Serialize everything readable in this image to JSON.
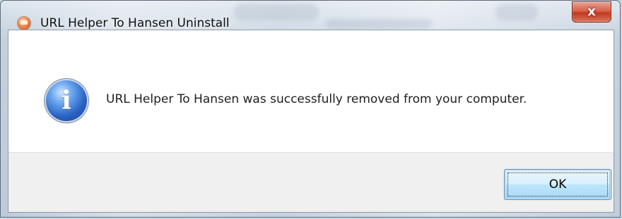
{
  "window": {
    "title": "URL Helper To Hansen Uninstall",
    "app_icon": "installer-app-icon",
    "close_symbol": "x"
  },
  "message": {
    "icon": "info-icon",
    "icon_glyph": "i",
    "text": "URL Helper To Hansen was successfully removed from your computer."
  },
  "buttons": {
    "ok_label": "OK"
  },
  "colors": {
    "close_button": "#c8432b",
    "ok_button_border": "#3c7fb1",
    "info_icon": "#2a64c6",
    "button_area_bg": "#f0f0f0"
  }
}
